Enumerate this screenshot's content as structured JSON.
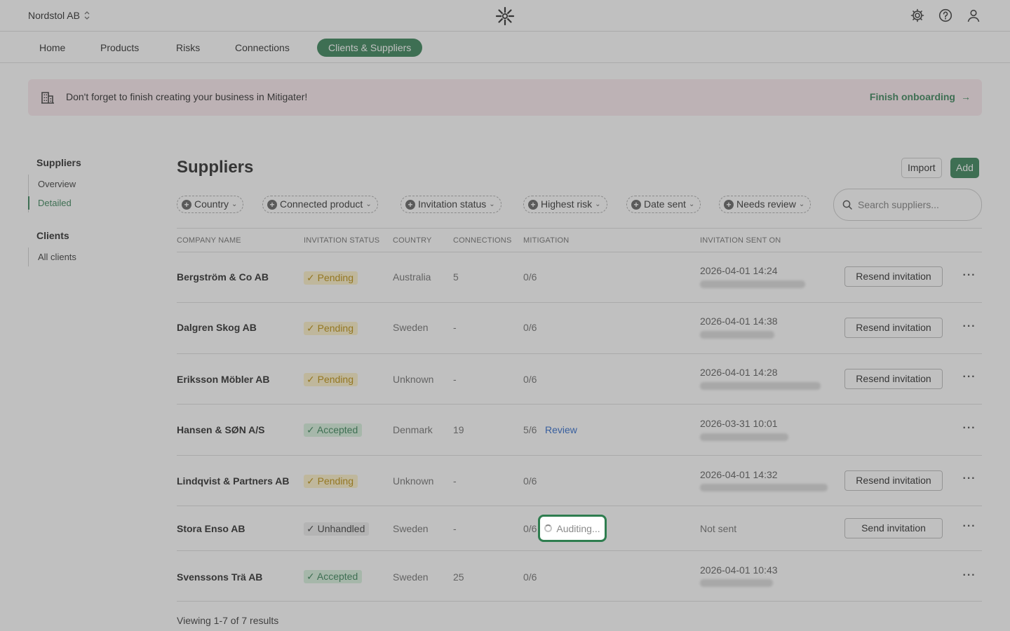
{
  "org": {
    "name": "Nordstol AB"
  },
  "nav": {
    "tabs": [
      {
        "label": "Home"
      },
      {
        "label": "Products"
      },
      {
        "label": "Risks"
      },
      {
        "label": "Connections"
      },
      {
        "label": "Clients & Suppliers",
        "active": true
      }
    ]
  },
  "banner": {
    "text": "Don't forget to finish creating your business in Mitigater!",
    "link": "Finish onboarding"
  },
  "sidebar": {
    "suppliers_heading": "Suppliers",
    "suppliers_items": [
      {
        "label": "Overview"
      },
      {
        "label": "Detailed",
        "active": true
      }
    ],
    "clients_heading": "Clients",
    "clients_items": [
      {
        "label": "All clients"
      }
    ]
  },
  "page": {
    "title": "Suppliers",
    "import_label": "Import",
    "add_label": "Add"
  },
  "filters": [
    {
      "label": "Country"
    },
    {
      "label": "Connected product"
    },
    {
      "label": "Invitation status"
    },
    {
      "label": "Highest risk"
    },
    {
      "label": "Date sent"
    },
    {
      "label": "Needs review"
    }
  ],
  "search": {
    "placeholder": "Search suppliers..."
  },
  "table": {
    "headers": [
      "COMPANY NAME",
      "INVITATION STATUS",
      "COUNTRY",
      "CONNECTIONS",
      "MITIGATION",
      "INVITATION SENT ON"
    ],
    "rows": [
      {
        "company": "Bergström & Co AB",
        "status": "Pending",
        "country": "Australia",
        "connections": "5",
        "mitigation": "0/6",
        "review": "",
        "sent": "2026-04-01 14:24",
        "action": "Resend invitation"
      },
      {
        "company": "Dalgren Skog AB",
        "status": "Pending",
        "country": "Sweden",
        "connections": "-",
        "mitigation": "0/6",
        "review": "",
        "sent": "2026-04-01 14:38",
        "action": "Resend invitation"
      },
      {
        "company": "Eriksson Möbler AB",
        "status": "Pending",
        "country": "Unknown",
        "connections": "-",
        "mitigation": "0/6",
        "review": "",
        "sent": "2026-04-01 14:28",
        "action": "Resend invitation"
      },
      {
        "company": "Hansen & SØN A/S",
        "status": "Accepted",
        "country": "Denmark",
        "connections": "19",
        "mitigation": "5/6",
        "review": "Review",
        "sent": "2026-03-31 10:01",
        "action": ""
      },
      {
        "company": "Lindqvist & Partners AB",
        "status": "Pending",
        "country": "Unknown",
        "connections": "-",
        "mitigation": "0/6",
        "review": "",
        "sent": "2026-04-01 14:32",
        "action": "Resend invitation"
      },
      {
        "company": "Stora Enso AB",
        "status": "Unhandled",
        "country": "Sweden",
        "connections": "-",
        "mitigation": "0/6",
        "review": "",
        "sent": "Not sent",
        "action": "Send invitation"
      },
      {
        "company": "Svenssons Trä AB",
        "status": "Accepted",
        "country": "Sweden",
        "connections": "25",
        "mitigation": "0/6",
        "review": "",
        "sent": "2026-04-01 10:43",
        "action": ""
      }
    ]
  },
  "auditing": {
    "label": "Auditing..."
  },
  "footer": {
    "text": "Viewing 1-7 of 7 results"
  },
  "colors": {
    "accent": "#2e7d4f",
    "link": "#2563c9",
    "banner_bg": "#fbe9ee"
  }
}
